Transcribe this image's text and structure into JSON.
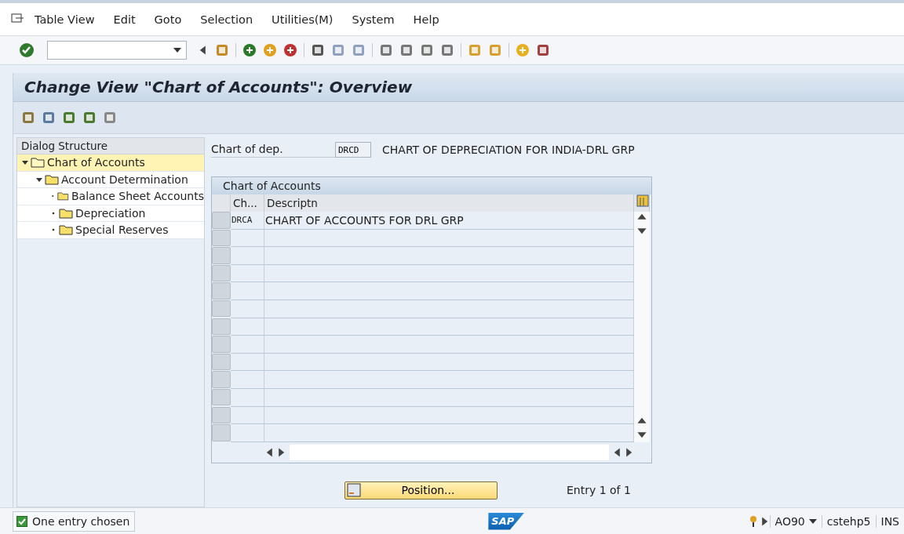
{
  "menu": [
    "Table View",
    "Edit",
    "Goto",
    "Selection",
    "Utilities(M)",
    "System",
    "Help"
  ],
  "title": "Change View \"Chart of Accounts\": Overview",
  "dialog_structure": {
    "heading": "Dialog Structure",
    "items": [
      {
        "label": "Chart of Accounts",
        "selected": true,
        "expanded": true,
        "children": [
          {
            "label": "Account Determination",
            "selected": false,
            "expanded": true,
            "children": [
              {
                "label": "Balance Sheet Accounts",
                "selected": false
              },
              {
                "label": "Depreciation",
                "selected": false
              },
              {
                "label": "Special Reserves",
                "selected": false
              }
            ]
          }
        ]
      }
    ]
  },
  "chart_of_dep": {
    "label": "Chart of dep.",
    "value": "DRCD",
    "description": "CHART OF DEPRECIATION FOR INDIA-DRL GRP"
  },
  "table": {
    "title": "Chart of Accounts",
    "columns": [
      "Ch...",
      "Descriptn"
    ],
    "rows": [
      {
        "cells": [
          "DRCA",
          "CHART OF ACCOUNTS FOR DRL GRP"
        ]
      }
    ]
  },
  "position_button": "Position...",
  "entry_count": "Entry 1 of 1",
  "status_bar": {
    "message": "One entry chosen",
    "logo": "SAP",
    "transaction": "AO90",
    "server": "cstehp5",
    "mode": "INS"
  }
}
